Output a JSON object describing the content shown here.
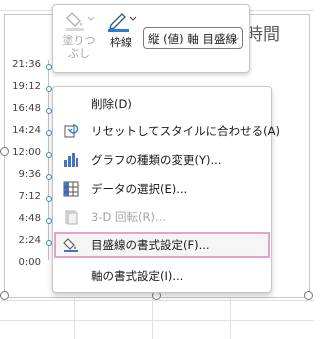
{
  "chart": {
    "title": "時間",
    "y_ticks": [
      "21:36",
      "19:12",
      "16:48",
      "14:24",
      "12:00",
      "9:36",
      "7:12",
      "4:48",
      "2:24",
      "0:00"
    ]
  },
  "toolbar": {
    "fill_label_1": "塗りつ",
    "fill_label_2": "ぶし",
    "line_label": "枠線",
    "axis_dropdown_value": "縦 (値) 軸 目盛線"
  },
  "menu": {
    "items": [
      {
        "label": "削除(D)",
        "icon": "none",
        "enabled": true
      },
      {
        "label": "リセットしてスタイルに合わせる(A)",
        "icon": "reset-style-icon",
        "enabled": true
      },
      {
        "label": "グラフの種類の変更(Y)...",
        "icon": "chart-type-icon",
        "enabled": true
      },
      {
        "label": "データの選択(E)...",
        "icon": "select-data-icon",
        "enabled": true
      },
      {
        "label": "3-D 回転(R)...",
        "icon": "rotate-3d-icon",
        "enabled": false
      },
      {
        "label": "目盛線の書式設定(F)...",
        "icon": "format-gridlines-icon",
        "enabled": true
      },
      {
        "label": "軸の書式設定(I)...",
        "icon": "none",
        "enabled": true
      }
    ]
  }
}
